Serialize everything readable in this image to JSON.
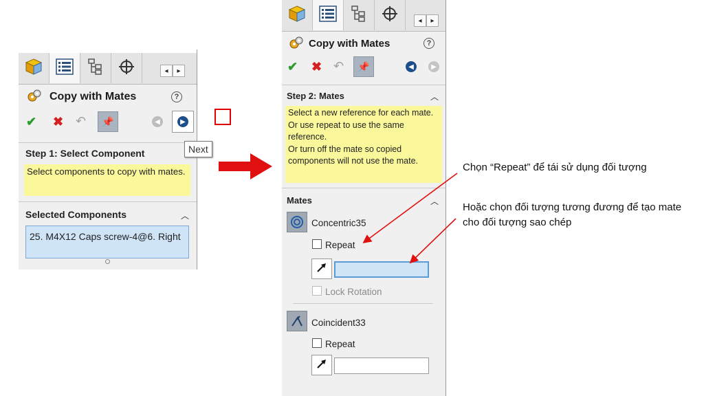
{
  "left_panel": {
    "title": "Copy with Mates",
    "help_icon": "question-icon",
    "step1_header": "Step 1: Select Component",
    "step1_message": "Select components to copy with mates.",
    "selected_header": "Selected Components",
    "selected_item": "25. M4X12 Caps screw-4@6. Right"
  },
  "tooltip": {
    "next_label": "Next"
  },
  "right_panel": {
    "title": "Copy with Mates",
    "step2_header": "Step 2: Mates",
    "step2_message": "Select a new reference for each mate.\nOr use repeat to use the same reference.\nOr turn off the mate so copied components will not use the mate.",
    "mates_header": "Mates",
    "mates": [
      {
        "name": "Concentric35",
        "repeat_label": "Repeat",
        "lock_label": "Lock Rotation"
      },
      {
        "name": "Coincident33",
        "repeat_label": "Repeat"
      }
    ]
  },
  "annotations": {
    "repeat_note": "Chọn “Repeat” để tái sử dụng đối tượng",
    "reference_note": "Hoặc chọn đối tượng tương đương để tạo mate cho đối tượng sao chép"
  },
  "colors": {
    "ok_green": "#2e9b2e",
    "cancel_red": "#d42020",
    "message_yellow": "#fbf89c",
    "selection_blue": "#cfe4f7",
    "arrow_red": "#e01010"
  }
}
